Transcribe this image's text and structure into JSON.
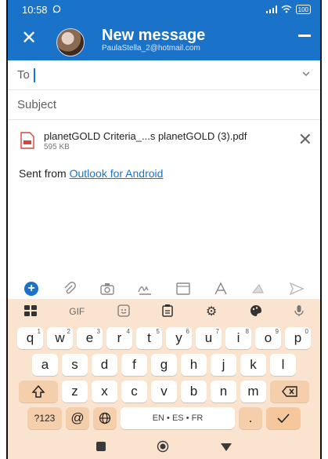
{
  "status_bar": {
    "time": "10:58",
    "battery": "100"
  },
  "header": {
    "title": "New message",
    "account": "PaulaStella_2@hotmail.com",
    "accent": "#1a73c8"
  },
  "to": {
    "label": "To"
  },
  "subject": {
    "placeholder": "Subject"
  },
  "attachment": {
    "name": "planetGOLD Criteria_...s planetGOLD (3).pdf",
    "size": "595 KB"
  },
  "body": {
    "prefix": "Sent from ",
    "link": "Outlook for Android"
  },
  "toolbar_icons": [
    "plus-icon",
    "attach-icon",
    "camera-icon",
    "signature-icon",
    "table-icon",
    "text-format-icon",
    "dictation-icon",
    "send-icon"
  ],
  "keyboard": {
    "top": {
      "gif": "GIF"
    },
    "row1": [
      {
        "k": "q",
        "n": "1"
      },
      {
        "k": "w",
        "n": "2"
      },
      {
        "k": "e",
        "n": "3"
      },
      {
        "k": "r",
        "n": "4"
      },
      {
        "k": "t",
        "n": "5"
      },
      {
        "k": "y",
        "n": "6"
      },
      {
        "k": "u",
        "n": "7"
      },
      {
        "k": "i",
        "n": "8"
      },
      {
        "k": "o",
        "n": "9"
      },
      {
        "k": "p",
        "n": "0"
      }
    ],
    "row2": [
      "a",
      "s",
      "d",
      "f",
      "g",
      "h",
      "j",
      "k",
      "l"
    ],
    "row3": [
      "z",
      "x",
      "c",
      "v",
      "b",
      "n",
      "m"
    ],
    "row4": {
      "symbols": "?123",
      "at": "@",
      "space": "EN • ES • FR",
      "period": "."
    }
  }
}
